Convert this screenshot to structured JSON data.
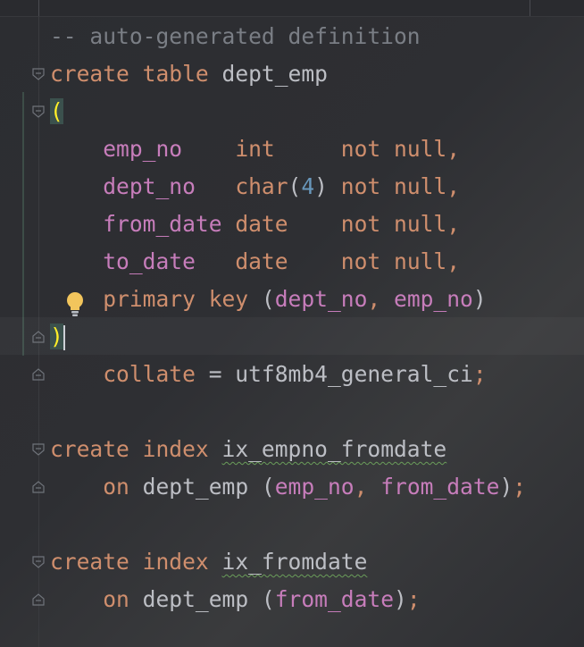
{
  "editor": {
    "lines": [
      [
        {
          "t": "-- auto-generated definition",
          "c": "comment"
        }
      ],
      [
        {
          "t": "create",
          "c": "kw"
        },
        {
          "t": " ",
          "c": "id"
        },
        {
          "t": "table",
          "c": "kw"
        },
        {
          "t": " dept_emp",
          "c": "id"
        }
      ],
      [
        {
          "t": "(",
          "c": "paren-hl"
        }
      ],
      [
        {
          "t": "    ",
          "c": "id"
        },
        {
          "t": "emp_no",
          "c": "col"
        },
        {
          "t": "    ",
          "c": "id"
        },
        {
          "t": "int",
          "c": "kw"
        },
        {
          "t": "     ",
          "c": "id"
        },
        {
          "t": "not null",
          "c": "kw"
        },
        {
          "t": ",",
          "c": "kw"
        }
      ],
      [
        {
          "t": "    ",
          "c": "id"
        },
        {
          "t": "dept_no",
          "c": "col"
        },
        {
          "t": "   ",
          "c": "id"
        },
        {
          "t": "char",
          "c": "kw"
        },
        {
          "t": "(",
          "c": "id"
        },
        {
          "t": "4",
          "c": "num"
        },
        {
          "t": ") ",
          "c": "id"
        },
        {
          "t": "not null",
          "c": "kw"
        },
        {
          "t": ",",
          "c": "kw"
        }
      ],
      [
        {
          "t": "    ",
          "c": "id"
        },
        {
          "t": "from_date",
          "c": "col"
        },
        {
          "t": " ",
          "c": "id"
        },
        {
          "t": "date",
          "c": "kw"
        },
        {
          "t": "    ",
          "c": "id"
        },
        {
          "t": "not null",
          "c": "kw"
        },
        {
          "t": ",",
          "c": "kw"
        }
      ],
      [
        {
          "t": "    ",
          "c": "id"
        },
        {
          "t": "to_date",
          "c": "col"
        },
        {
          "t": "   ",
          "c": "id"
        },
        {
          "t": "date",
          "c": "kw"
        },
        {
          "t": "    ",
          "c": "id"
        },
        {
          "t": "not null",
          "c": "kw"
        },
        {
          "t": ",",
          "c": "kw"
        }
      ],
      [
        {
          "t": "    ",
          "c": "id"
        },
        {
          "t": "primary key",
          "c": "kw"
        },
        {
          "t": " (",
          "c": "id"
        },
        {
          "t": "dept_no",
          "c": "col"
        },
        {
          "t": ", ",
          "c": "kw"
        },
        {
          "t": "emp_no",
          "c": "col"
        },
        {
          "t": ")",
          "c": "id"
        }
      ],
      [
        {
          "t": ")",
          "c": "paren-hl"
        },
        {
          "t": "",
          "c": "caret"
        }
      ],
      [
        {
          "t": "    ",
          "c": "id"
        },
        {
          "t": "collate",
          "c": "kw"
        },
        {
          "t": " = utf8mb4_general_ci",
          "c": "id"
        },
        {
          "t": ";",
          "c": "kw"
        }
      ],
      [],
      [
        {
          "t": "create",
          "c": "kw"
        },
        {
          "t": " ",
          "c": "id"
        },
        {
          "t": "index",
          "c": "kw"
        },
        {
          "t": " ",
          "c": "id"
        },
        {
          "t": "ix_empno_fromdate",
          "c": "id-squiggle"
        }
      ],
      [
        {
          "t": "    ",
          "c": "id"
        },
        {
          "t": "on",
          "c": "kw"
        },
        {
          "t": " dept_emp (",
          "c": "id"
        },
        {
          "t": "emp_no",
          "c": "col"
        },
        {
          "t": ", ",
          "c": "kw"
        },
        {
          "t": "from_date",
          "c": "col"
        },
        {
          "t": ")",
          "c": "id"
        },
        {
          "t": ";",
          "c": "kw"
        }
      ],
      [],
      [
        {
          "t": "create",
          "c": "kw"
        },
        {
          "t": " ",
          "c": "id"
        },
        {
          "t": "index",
          "c": "kw"
        },
        {
          "t": " ",
          "c": "id"
        },
        {
          "t": "ix_fromdate",
          "c": "id-squiggle"
        }
      ],
      [
        {
          "t": "    ",
          "c": "id"
        },
        {
          "t": "on",
          "c": "kw"
        },
        {
          "t": " dept_emp (",
          "c": "id"
        },
        {
          "t": "from_date",
          "c": "col"
        },
        {
          "t": ")",
          "c": "id"
        },
        {
          "t": ";",
          "c": "kw"
        }
      ]
    ],
    "fold_markers": [
      {
        "line": 1,
        "kind": "fold-open-icon"
      },
      {
        "line": 2,
        "kind": "fold-open-icon"
      },
      {
        "line": 8,
        "kind": "fold-close-icon"
      },
      {
        "line": 9,
        "kind": "fold-close-icon"
      },
      {
        "line": 11,
        "kind": "fold-open-icon"
      },
      {
        "line": 12,
        "kind": "fold-close-icon"
      },
      {
        "line": 14,
        "kind": "fold-open-icon"
      },
      {
        "line": 15,
        "kind": "fold-close-icon"
      }
    ],
    "intention_icon": "lightbulb-icon",
    "colors": {
      "keyword": "#cf8e6d",
      "identifier": "#bcbec4",
      "column": "#c77dbb",
      "number": "#6897bb",
      "comment": "#7a7e85",
      "bracket_highlight": "#ffef28"
    }
  }
}
